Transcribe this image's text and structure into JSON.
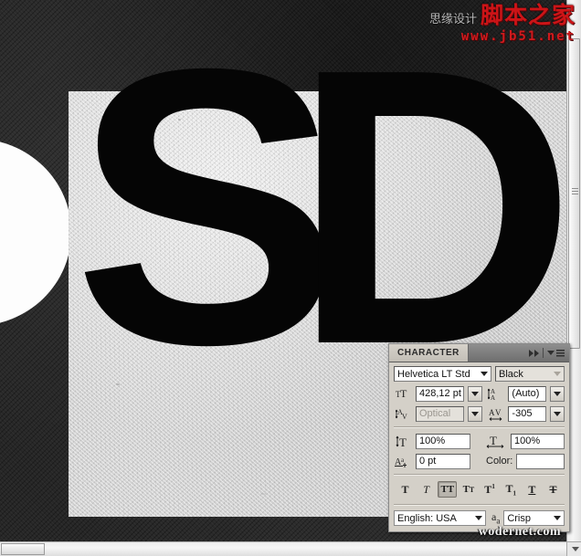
{
  "app": {
    "background_color": "#262626",
    "canvas_color": "#d4d4d4",
    "artwork_letters": "SD",
    "glyph_s": "S",
    "glyph_d": "D"
  },
  "panel": {
    "tab_label": "CHARACTER",
    "collapse_icon": "double-right-arrow-icon",
    "menu_icon": "panel-menu-icon",
    "font_family": {
      "value": "Helvetica LT Std",
      "icon": "chevron-down-icon"
    },
    "font_style": {
      "value": "Black",
      "icon": "chevron-down-icon",
      "disabled": true
    },
    "font_size": {
      "icon": "font-size-icon",
      "value": "428,12 pt"
    },
    "leading": {
      "icon": "leading-icon",
      "value": "(Auto)"
    },
    "kerning": {
      "icon": "kerning-icon",
      "value": "Optical",
      "disabled": true
    },
    "tracking": {
      "icon": "tracking-icon",
      "value": "-305"
    },
    "vertical_scale": {
      "icon": "vertical-scale-icon",
      "value": "100%"
    },
    "horizontal_scale": {
      "icon": "horizontal-scale-icon",
      "value": "100%"
    },
    "baseline_shift": {
      "icon": "baseline-shift-icon",
      "value": "0 pt"
    },
    "color": {
      "label": "Color:",
      "value": "#ffffff"
    },
    "style_buttons": [
      {
        "name": "faux-bold",
        "glyph": "T",
        "active": false
      },
      {
        "name": "faux-italic",
        "glyph": "T",
        "active": false
      },
      {
        "name": "all-caps",
        "glyph": "TT",
        "active": true
      },
      {
        "name": "small-caps",
        "glyph": "TT",
        "active": false
      },
      {
        "name": "superscript",
        "glyph": "T1",
        "active": false
      },
      {
        "name": "subscript",
        "glyph": "T1",
        "active": false
      },
      {
        "name": "underline",
        "glyph": "T",
        "active": false
      },
      {
        "name": "strikethrough",
        "glyph": "T",
        "active": false
      }
    ],
    "language": {
      "value": "English: USA",
      "icon": "chevron-down-icon"
    },
    "antialias": {
      "icon": "aa-icon",
      "value": "Crisp"
    }
  },
  "watermark": {
    "cn_gray": "思缘设计",
    "cn_red": "脚本之家",
    "url": "www.jb51.net",
    "bottom": "wodernet.com"
  },
  "scrollbars": {
    "vertical": "vertical-scrollbar",
    "horizontal": "horizontal-scrollbar"
  }
}
